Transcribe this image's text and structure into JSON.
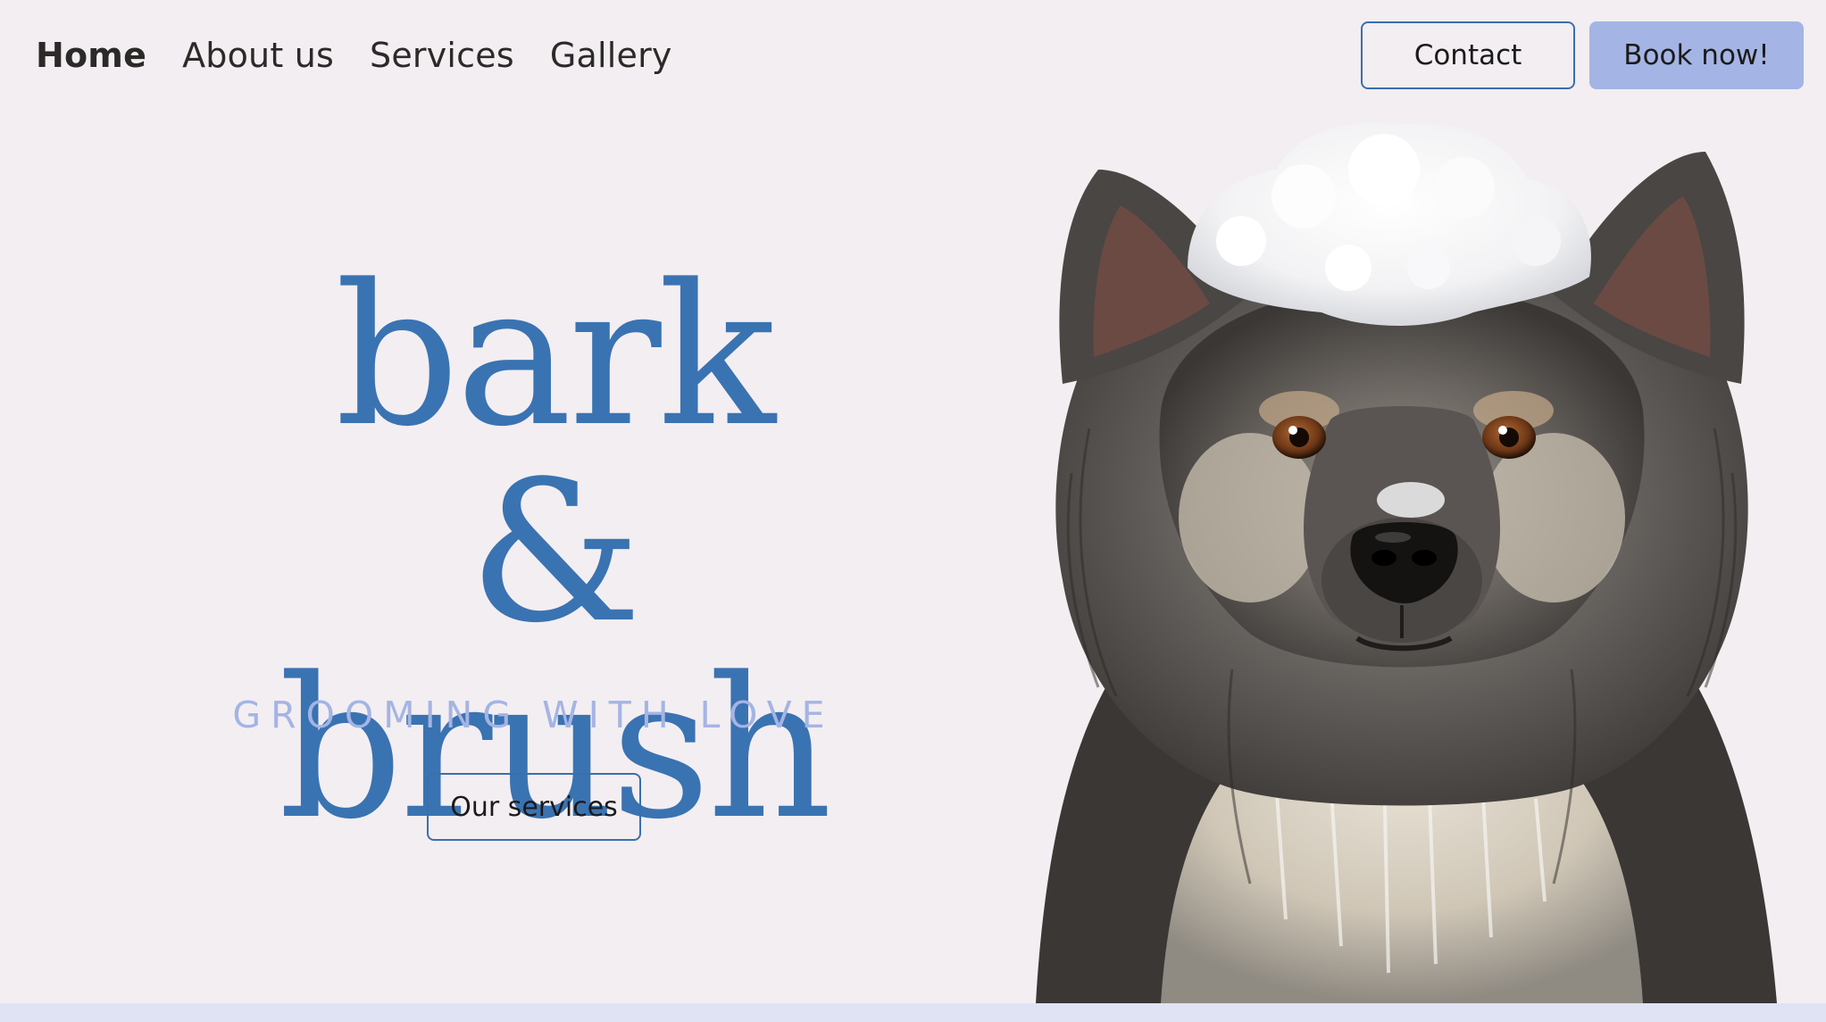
{
  "nav": {
    "links": [
      {
        "label": "Home",
        "active": true
      },
      {
        "label": "About us",
        "active": false
      },
      {
        "label": "Services",
        "active": false
      },
      {
        "label": "Gallery",
        "active": false
      }
    ],
    "contact_label": "Contact",
    "book_label": "Book now!"
  },
  "hero": {
    "title_line1": "bark &",
    "title_line2": "brush",
    "subtitle": "GROOMING WITH LOVE",
    "cta_label": "Our services"
  },
  "colors": {
    "background": "#f3eef1",
    "brand_blue": "#3a73b2",
    "accent_lavender": "#a4b4e4",
    "text_dark": "#2c2a29"
  },
  "media": {
    "hero_image": "dog-with-foam-illustration"
  }
}
